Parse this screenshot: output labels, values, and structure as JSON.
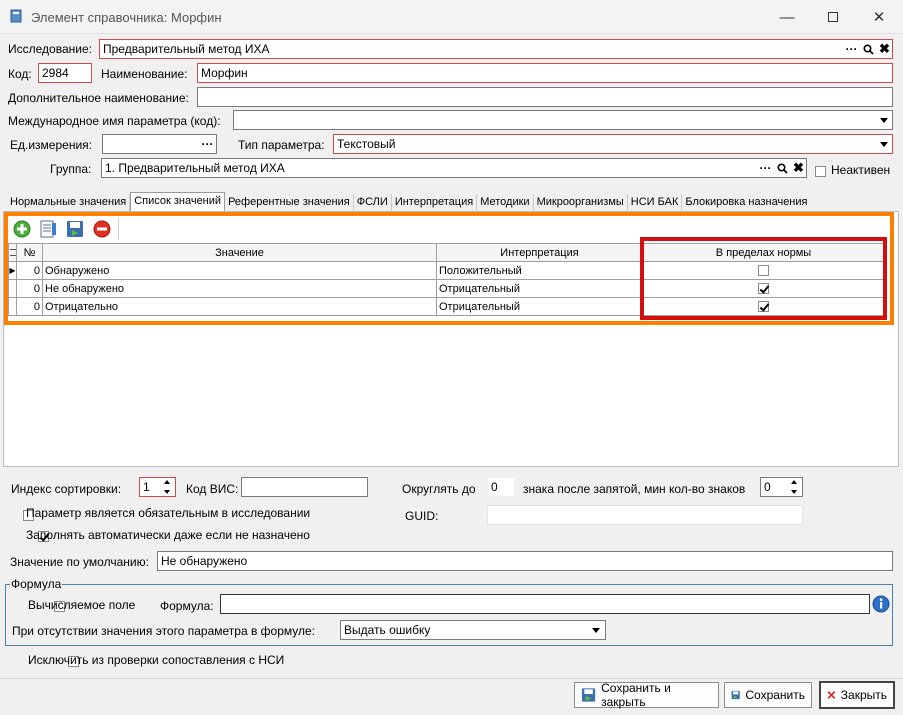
{
  "window": {
    "title": "Элемент справочника: Морфин"
  },
  "form": {
    "research_label": "Исследование:",
    "research_value": "Предварительный метод ИХА",
    "code_label": "Код:",
    "code_value": "2984",
    "name_label": "Наименование:",
    "name_value": "Морфин",
    "alt_name_label": "Дополнительное наименование:",
    "alt_name_value": "",
    "intl_name_label": "Международное имя параметра (код):",
    "intl_name_value": "",
    "unit_label": "Ед.измерения:",
    "unit_value": "",
    "type_label": "Тип параметра:",
    "type_value": "Текстовый",
    "group_label": "Группа:",
    "group_value": "1. Предварительный метод ИХА",
    "inactive_label": "Неактивен",
    "inactive_checked": false,
    "dots": "···"
  },
  "tabs": [
    {
      "label": "Нормальные значения",
      "active": false
    },
    {
      "label": "Список значений",
      "active": true
    },
    {
      "label": "Референтные значения",
      "active": false
    },
    {
      "label": "ФСЛИ",
      "active": false
    },
    {
      "label": "Интерпретация",
      "active": false
    },
    {
      "label": "Методики",
      "active": false
    },
    {
      "label": "Микроорганизмы",
      "active": false
    },
    {
      "label": "НСИ БАК",
      "active": false
    },
    {
      "label": "Блокировка назначения",
      "active": false
    }
  ],
  "grid": {
    "columns": [
      "№",
      "Значение",
      "Интерпретация",
      "В пределах нормы"
    ],
    "rows": [
      {
        "num": "0",
        "value": "Обнаружено",
        "interpretation": "Положительный",
        "in_norm": false
      },
      {
        "num": "0",
        "value": "Не обнаружено",
        "interpretation": "Отрицательный",
        "in_norm": true
      },
      {
        "num": "0",
        "value": "Отрицательно",
        "interpretation": "Отрицательный",
        "in_norm": true
      }
    ]
  },
  "bottom": {
    "sort_index_label": "Индекс сортировки:",
    "sort_index_value": "1",
    "vis_code_label": "Код ВИС:",
    "vis_code_value": "",
    "round_label": "Округлять до",
    "round_value": "0",
    "round_suffix": "знака после запятой, мин кол-во знаков",
    "min_digits_value": "0",
    "required_label": "Параметр является обязательным в исследовании",
    "required_checked": false,
    "guid_label": "GUID:",
    "guid_value": "",
    "autofill_label": "Заполнять автоматически даже если не назначено",
    "autofill_checked": true,
    "default_label": "Значение по умолчанию:",
    "default_value": "Не обнаружено",
    "formula_group_label": "Формула",
    "calculated_label": "Вычисляемое поле",
    "calculated_checked": false,
    "formula_label": "Формула:",
    "formula_value": "",
    "missing_label": "При отсутствии значения этого параметра в формуле:",
    "missing_value": "Выдать ошибку",
    "exclude_label": "Исключить из проверки сопоставления с НСИ",
    "exclude_checked": false
  },
  "buttons": {
    "save_close": "Сохранить и закрыть",
    "save": "Сохранить",
    "close": "Закрыть"
  },
  "colors": {
    "highlight_orange": "#ff8000",
    "highlight_red": "#d10f0f",
    "required_border": "#d04a4a"
  }
}
